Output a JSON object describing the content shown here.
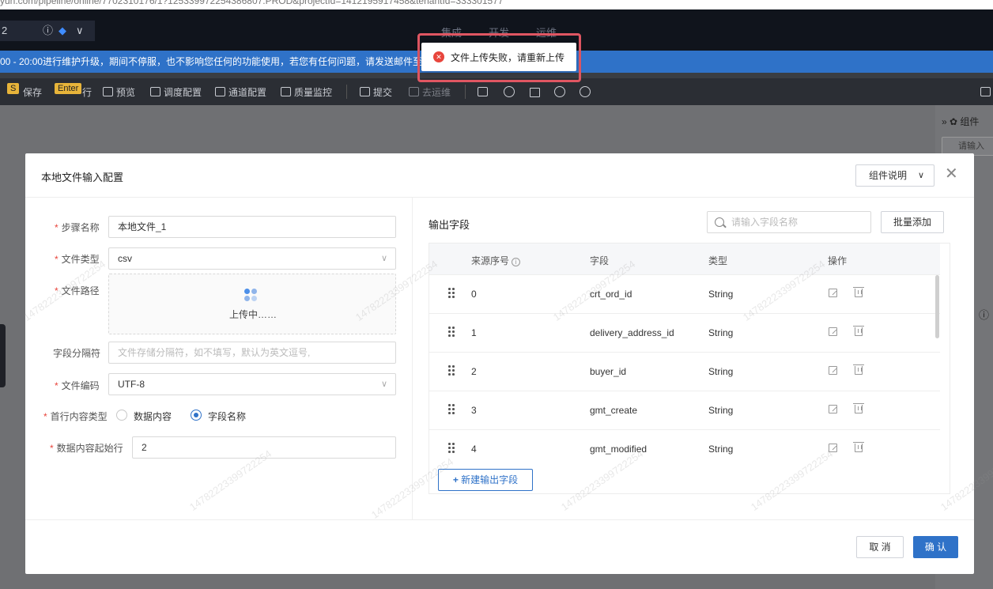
{
  "browser": {
    "url": "yun.com/pipeline/online/7702310176/1?125339972254386807.PROD&projectId=1412195917458&tenantId=333301577"
  },
  "topnav": {
    "project_value": "2",
    "menus": [
      "集成",
      "开发",
      "运维"
    ]
  },
  "notice": {
    "text": "00 - 20:00进行维护升级，期间不停服，也不影响您任何的功能使用，若您有任何问题，请发送邮件至"
  },
  "toolbar": {
    "save_badge": "S",
    "save": "保存",
    "enter_badge": "Enter",
    "run_suffix": "行",
    "preview": "预览",
    "schedule": "调度配置",
    "channel": "通道配置",
    "quality": "质量监控",
    "submit": "提交",
    "ops": "去运维"
  },
  "right_panel": {
    "head": "组件",
    "search_placeholder": "请输入"
  },
  "toast": {
    "message": "文件上传失败，请重新上传"
  },
  "modal": {
    "title": "本地文件输入配置",
    "doc_button": "组件说明",
    "form": {
      "step_name_label": "步骤名称",
      "step_name_value": "本地文件_1",
      "file_type_label": "文件类型",
      "file_type_value": "csv",
      "file_path_label": "文件路径",
      "uploading_text": "上传中……",
      "separator_label": "字段分隔符",
      "separator_placeholder": "文件存储分隔符，如不填写，默认为英文逗号,",
      "encoding_label": "文件编码",
      "encoding_value": "UTF-8",
      "first_row_label": "首行内容类型",
      "first_row_options": [
        "数据内容",
        "字段名称"
      ],
      "first_row_selected": "字段名称",
      "data_start_label": "数据内容起始行",
      "data_start_value": "2"
    },
    "output": {
      "title": "输出字段",
      "search_placeholder": "请输入字段名称",
      "batch_add": "批量添加",
      "columns": [
        "来源序号",
        "字段",
        "类型",
        "操作"
      ],
      "rows": [
        {
          "index": "0",
          "field": "crt_ord_id",
          "type": "String"
        },
        {
          "index": "1",
          "field": "delivery_address_id",
          "type": "String"
        },
        {
          "index": "2",
          "field": "buyer_id",
          "type": "String"
        },
        {
          "index": "3",
          "field": "gmt_create",
          "type": "String"
        },
        {
          "index": "4",
          "field": "gmt_modified",
          "type": "String"
        }
      ],
      "add_field": "新建输出字段"
    },
    "cancel": "取 消",
    "confirm": "确 认"
  },
  "watermark": "14782223399722254"
}
